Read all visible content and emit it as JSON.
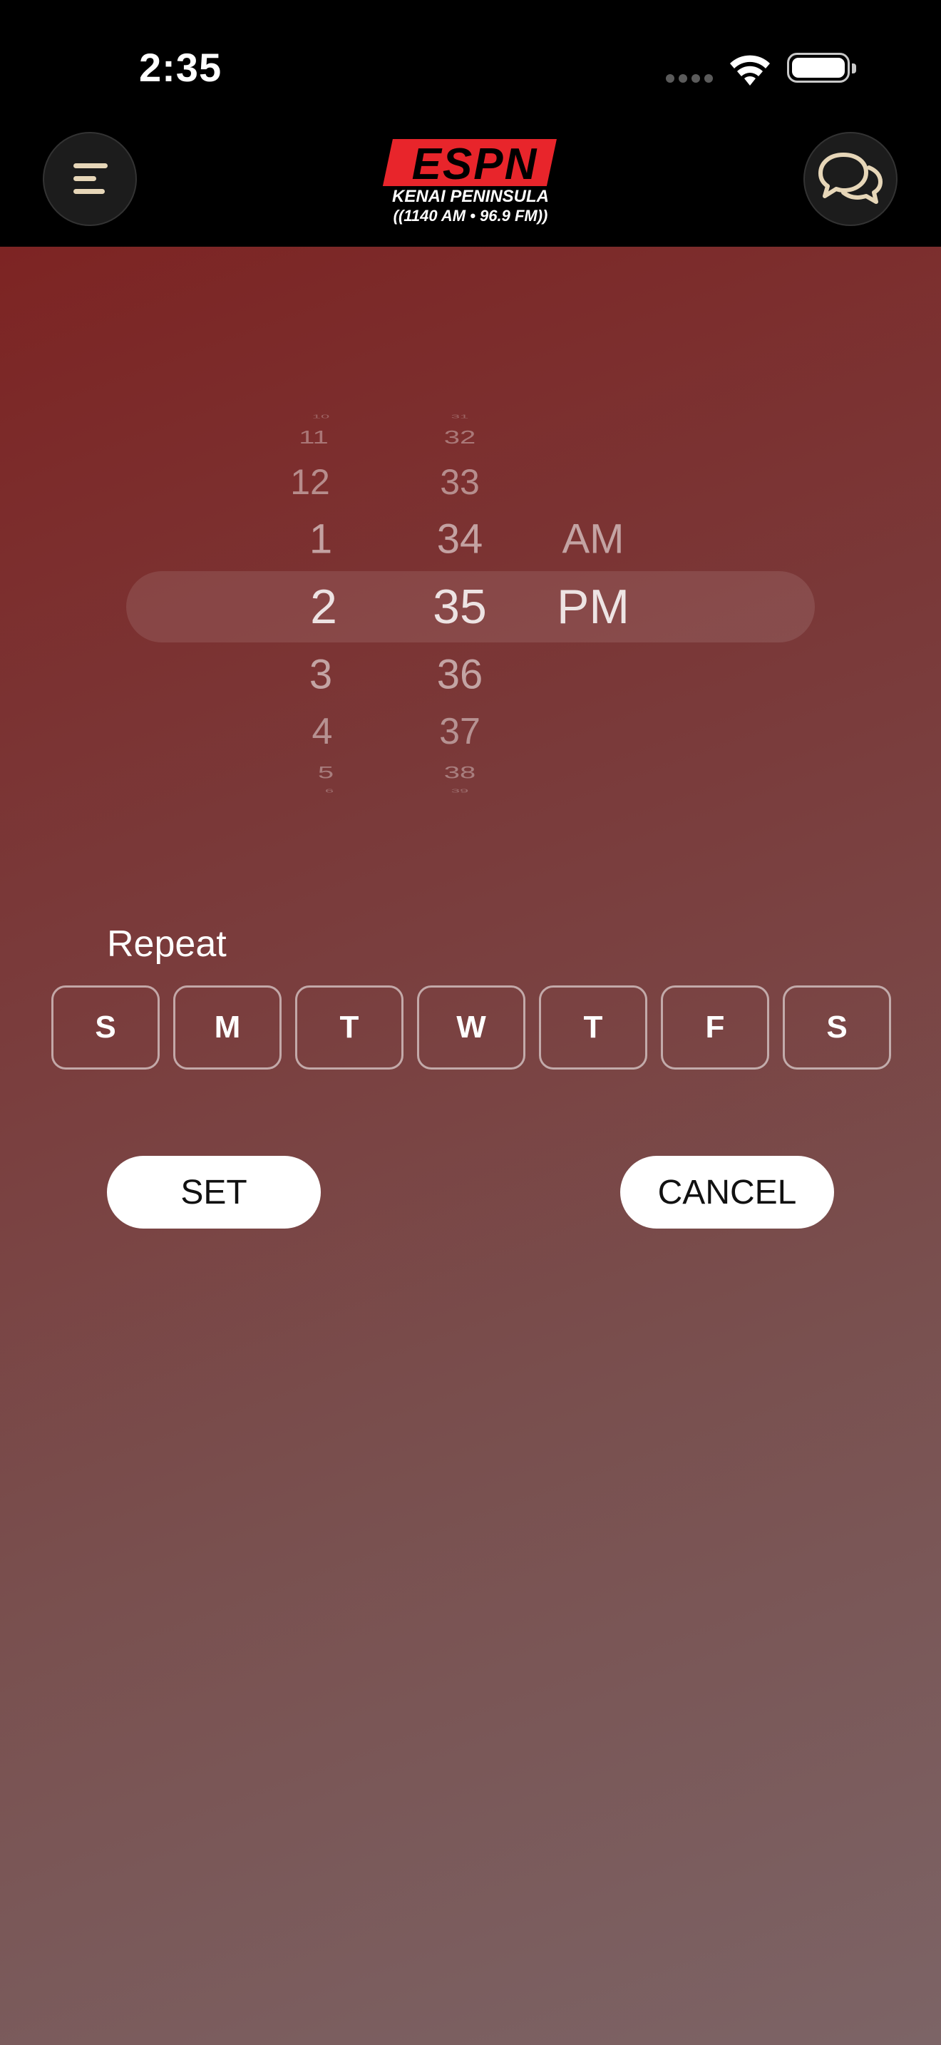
{
  "status_bar": {
    "time": "2:35"
  },
  "header": {
    "logo_text": "ESPN",
    "logo_subtitle": "KENAI PENINSULA",
    "logo_frequency": "((1140 AM • 96.9 FM))",
    "menu_icon": "menu-icon",
    "chat_icon": "chat-bubbles-icon"
  },
  "picker": {
    "hours": [
      "10",
      "11",
      "12",
      "1",
      "2",
      "3",
      "4",
      "5",
      "6"
    ],
    "minutes": [
      "31",
      "32",
      "33",
      "34",
      "35",
      "36",
      "37",
      "38",
      "39"
    ],
    "ampm": [
      "AM",
      "PM"
    ],
    "selected_hour": "2",
    "selected_minute": "35",
    "selected_ampm": "PM"
  },
  "repeat": {
    "label": "Repeat",
    "days": [
      "S",
      "M",
      "T",
      "W",
      "T",
      "F",
      "S"
    ]
  },
  "actions": {
    "set_label": "SET",
    "cancel_label": "CANCEL"
  },
  "colors": {
    "header_bg": "#000000",
    "gradient_start": "#7d2423",
    "gradient_end": "#7c6466",
    "logo_red": "#e8252b"
  }
}
